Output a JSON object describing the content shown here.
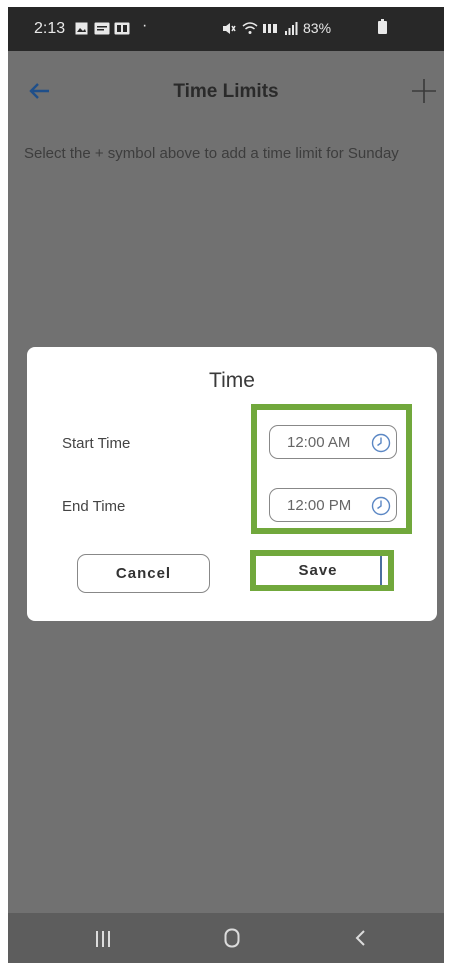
{
  "status_bar": {
    "time": "2:13",
    "dot": "·",
    "battery": "83%",
    "icons": [
      "gallery-icon",
      "message-icon",
      "app-icon",
      "mute-icon",
      "wifi-icon",
      "lte-icon",
      "signal-icon",
      "battery-icon"
    ]
  },
  "header": {
    "title": "Time Limits",
    "back_icon": "back-arrow-icon",
    "add_icon": "plus-icon",
    "accent_color": "#1f4f8a"
  },
  "instruction": "Select the + symbol above to add a time limit for Sunday",
  "dialog": {
    "title": "Time",
    "start_label": "Start Time",
    "start_value": "12:00 AM",
    "end_label": "End Time",
    "end_value": "12:00 PM",
    "cancel_label": "Cancel",
    "save_label": "Save",
    "highlight_color": "#71a83c"
  },
  "nav_bar": {
    "recents_icon": "recents-icon",
    "home_icon": "home-icon",
    "back_icon": "back-chevron-icon"
  }
}
